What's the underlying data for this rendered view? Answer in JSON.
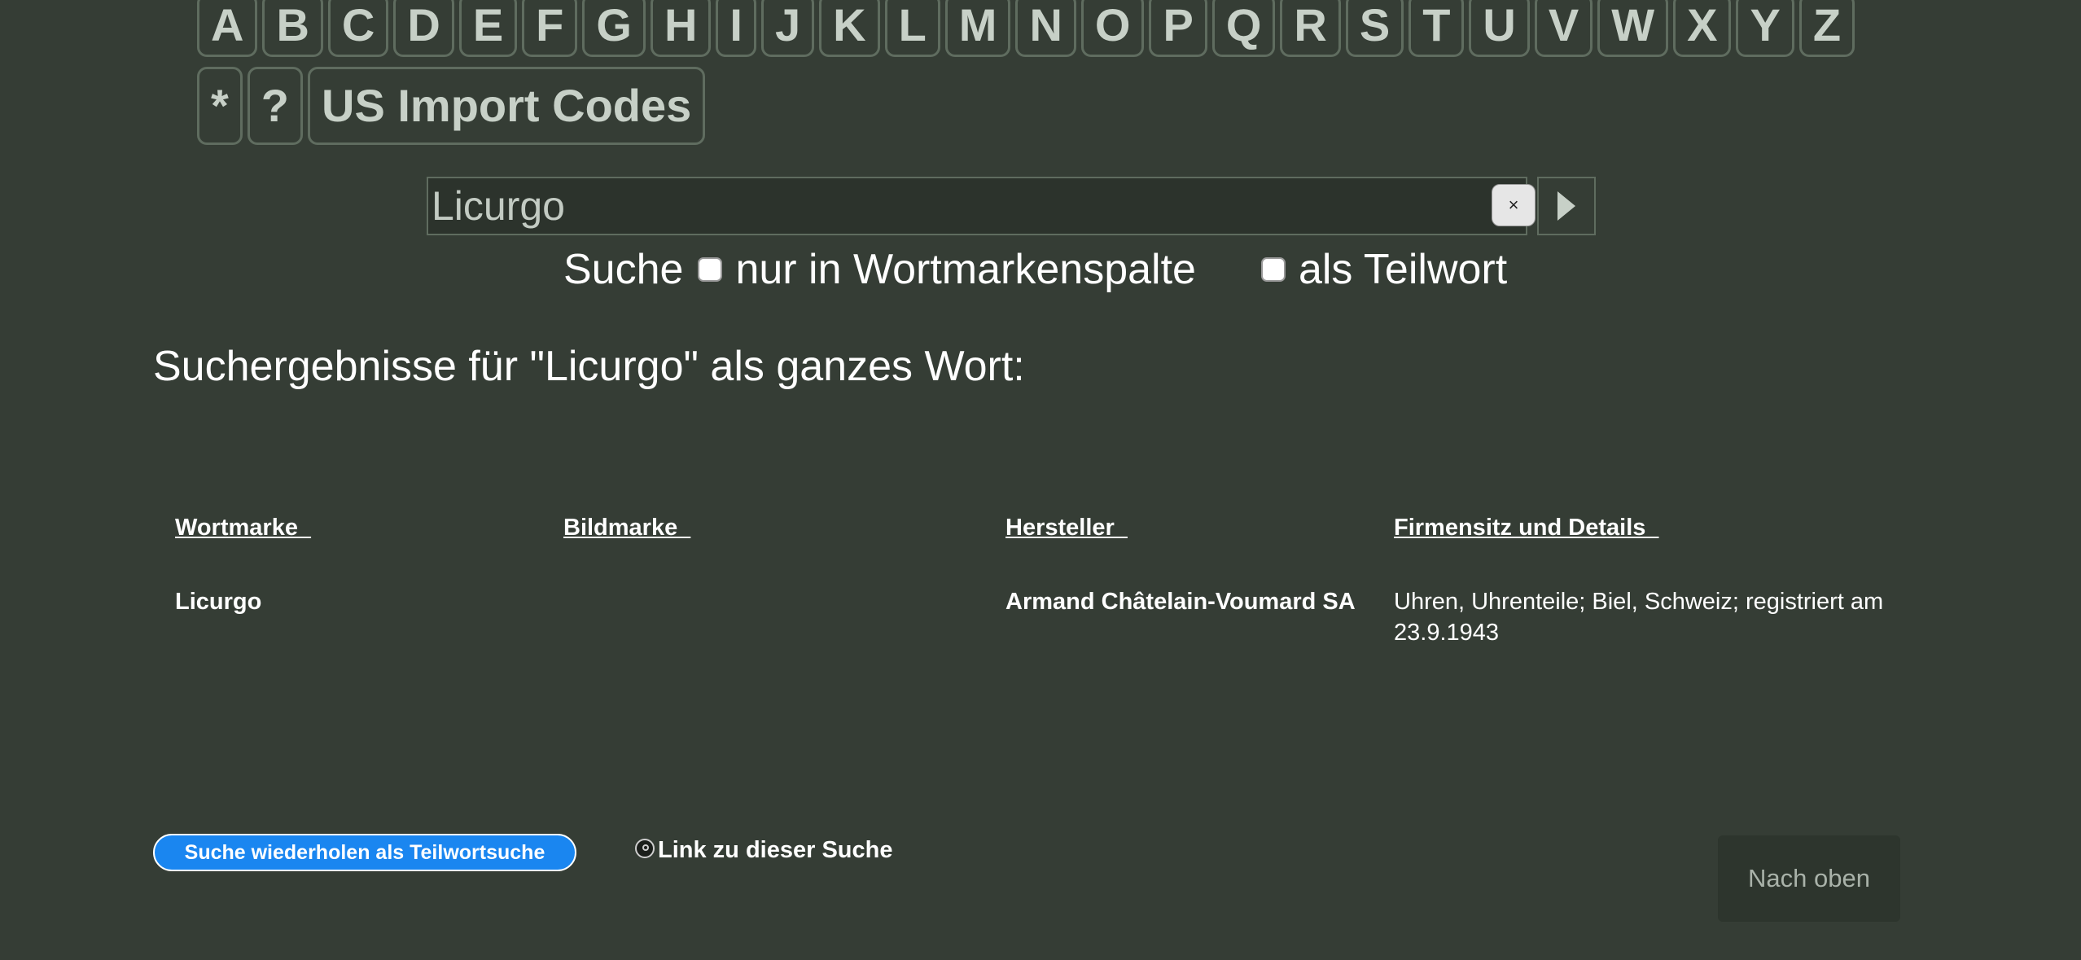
{
  "letters": [
    "A",
    "B",
    "C",
    "D",
    "E",
    "F",
    "G",
    "H",
    "I",
    "J",
    "K",
    "L",
    "M",
    "N",
    "O",
    "P",
    "Q",
    "R",
    "S",
    "T",
    "U",
    "V",
    "W",
    "X",
    "Y",
    "Z"
  ],
  "extra_keys": {
    "star": "*",
    "question": "?",
    "us_import": "US Import Codes"
  },
  "search": {
    "value": "Licurgo",
    "clear_label": "×"
  },
  "options": {
    "prefix": "Suche",
    "only_wordmark": "nur in Wortmarkenspalte",
    "partial_word": "als Teilwort"
  },
  "results_heading": "Suchergebnisse für \"Licurgo\" als ganzes Wort:",
  "table": {
    "headers": {
      "wortmarke": "Wortmarke  ",
      "bildmarke": "Bildmarke  ",
      "hersteller": "Hersteller  ",
      "firmensitz": "Firmensitz und Details  "
    },
    "rows": [
      {
        "wortmarke": "Licurgo",
        "bildmarke": "",
        "hersteller": "Armand Châtelain-Voumard SA",
        "firmensitz": "Uhren, Uhrenteile; Biel, Schweiz; registriert am 23.9.1943"
      }
    ]
  },
  "bottom": {
    "repeat_label": "Suche wiederholen als Teilwortsuche",
    "link_label": "Link zu dieser Suche",
    "top_label": "Nach oben"
  },
  "colors": {
    "background": "#353d35",
    "accent_button": "#1a86f0"
  }
}
